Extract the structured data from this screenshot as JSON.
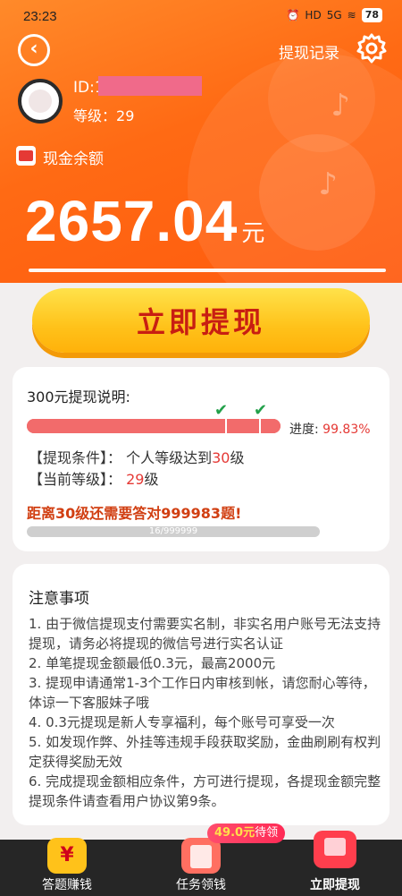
{
  "status_bar": {
    "time": "23:23",
    "battery": "78",
    "signal": "5G"
  },
  "header": {
    "withdraw_record": "提现记录",
    "user_id_prefix": "ID:1",
    "level_label": "等级：",
    "level_value": "29",
    "cash_label": "现金余额",
    "balance": "2657.04",
    "balance_unit": "元"
  },
  "action": {
    "withdraw_now": "立即提现"
  },
  "withdraw_info": {
    "title": "300元提现说明:",
    "progress_label": "进度:",
    "progress_value": "99.83%",
    "progress_fraction": 0.9983,
    "condition_label": "【提现条件】：",
    "condition_text_prefix": "个人等级达到",
    "condition_level": "30",
    "condition_suffix": "级",
    "current_label": "【当前等级】：",
    "current_level": "29",
    "current_suffix": "级",
    "distance_text": "距离30级还需要答对999983题!",
    "question_progress": "16/999999"
  },
  "notice": {
    "title": "注意事项",
    "items": [
      "1. 由于微信提现支付需要实名制，非实名用户账号无法支持提现，请务必将提现的微信号进行实名认证",
      "2. 单笔提现金额最低0.3元，最高2000元",
      "3. 提现申请通常1-3个工作日内审核到帐，请您耐心等待，体谅一下客服妹子哦",
      "4. 0.3元提现是新人专享福利，每个账号可享受一次",
      "5. 如发现作弊、外挂等违规手段获取奖励，金曲刷刷有权判定获得奖励无效",
      "6. 完成提现金额相应条件，方可进行提现，各提现金额完整提现条件请查看用户协议第9条。"
    ]
  },
  "bottom_nav": {
    "pending_amount": "49.0元",
    "pending_label": "待领",
    "items": [
      {
        "label": "答题赚钱",
        "icon": "yuan-icon"
      },
      {
        "label": "任务领钱",
        "icon": "task-icon"
      },
      {
        "label": "立即提现",
        "icon": "withdraw-icon"
      }
    ]
  },
  "colors": {
    "accent": "#ff6a14",
    "button": "#ffc21a",
    "highlight": "#e53935"
  }
}
